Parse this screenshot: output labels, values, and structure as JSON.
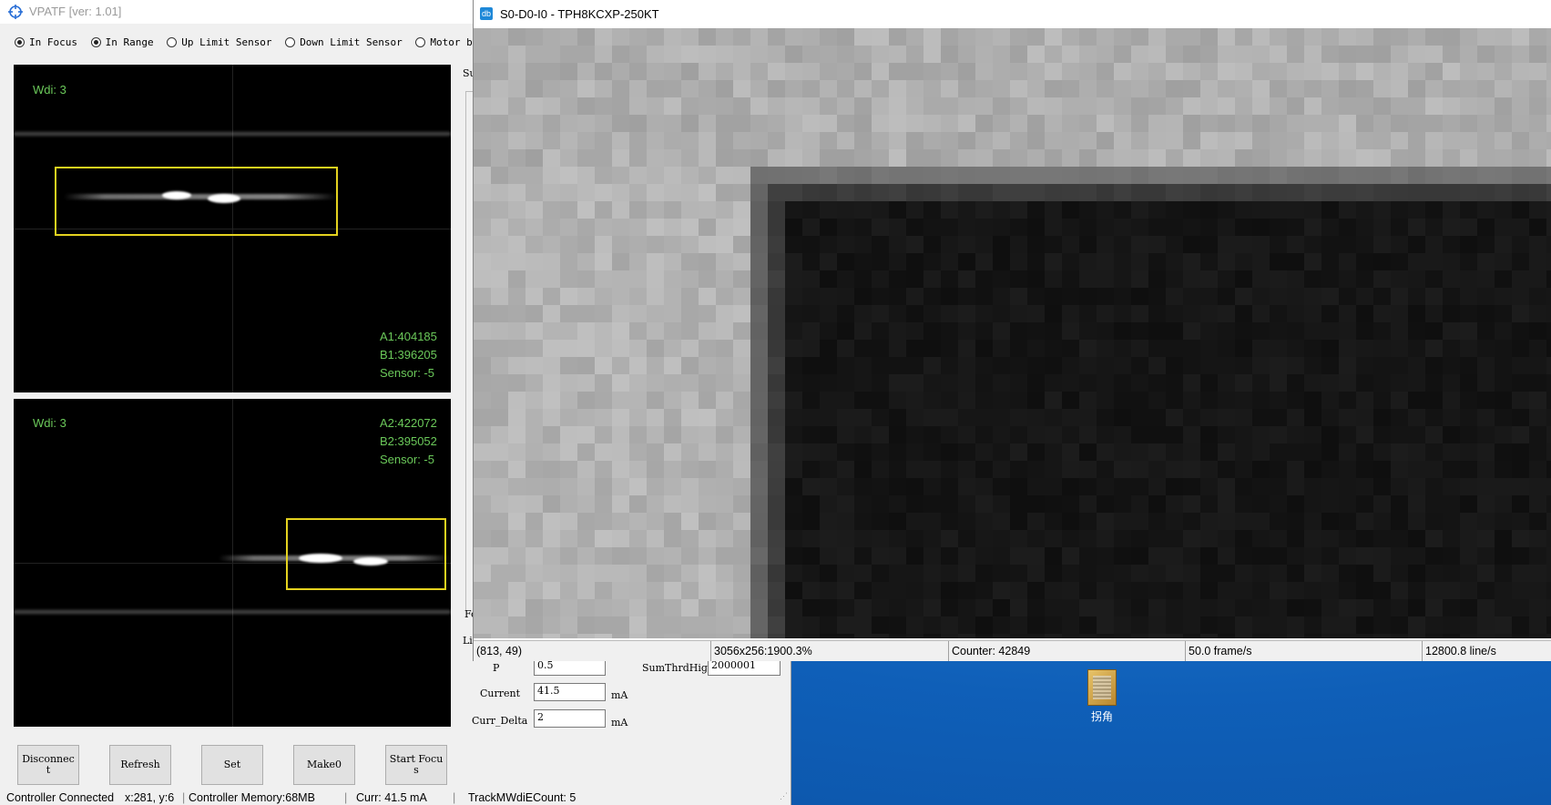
{
  "vpatf": {
    "title": "VPATF [ver: 1.01]",
    "radios": [
      {
        "label": "In Focus",
        "checked": true
      },
      {
        "label": "In Range",
        "checked": true
      },
      {
        "label": "Up Limit Sensor",
        "checked": false
      },
      {
        "label": "Down Limit Sensor",
        "checked": false
      },
      {
        "label": "Motor busy",
        "checked": false
      }
    ],
    "cam_top": {
      "wdi": "Wdi: 3",
      "a": "A1:404185",
      "b": "B1:396205",
      "sensor": "Sensor: -5"
    },
    "cam_bottom": {
      "wdi": "Wdi: 3",
      "a": "A2:422072",
      "b": "B2:395052",
      "sensor": "Sensor: -5"
    },
    "partial_labels": {
      "su": "Su",
      "fo": "Fo",
      "li": "Li"
    },
    "form": {
      "p_label": "P",
      "p_value": "0.5",
      "sumthrdhigh_label": "SumThrdHigh",
      "sumthrdhigh_value": "2000001",
      "current_label": "Current",
      "current_value": "41.5",
      "current_unit": "mA",
      "curr_delta_label": "Curr_Delta",
      "curr_delta_value": "2",
      "curr_delta_unit": "mA"
    },
    "buttons": {
      "disconnect": "Disconnect",
      "refresh": "Refresh",
      "set": "Set",
      "make0": "Make0",
      "start_focus": "Start Focus"
    },
    "status": {
      "connection": "Controller Connected",
      "xy": "x:281, y:6",
      "memory": "Controller Memory:68MB",
      "curr": "Curr: 41.5  mA",
      "trackcount": "TrackMWdiECount: 5"
    }
  },
  "viewer": {
    "icon": "db",
    "title": "S0-D0-I0 - TPH8KCXP-250KT",
    "status": {
      "coords": "(813, 49)",
      "resolution": "3056x256:1900.3%",
      "counter": "Counter: 42849",
      "fps": "50.0 frame/s",
      "lps": "12800.8 line/s"
    }
  },
  "desktop": {
    "icon_label": "拐角",
    "icon_name": "folder-icon"
  },
  "colors": {
    "overlay_text": "#6bc95a",
    "roi": "#e4d21f",
    "desktop": "#0f5fb8"
  }
}
